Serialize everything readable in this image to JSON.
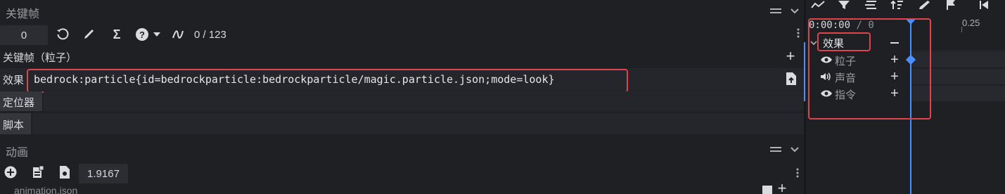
{
  "keyframe_panel": {
    "title": "关键帧",
    "frame_value": "0",
    "frame_count": "0 / 123",
    "section_label": "关键帧（粒子）",
    "effect_label": "效果",
    "effect_value": "bedrock:particle{id=bedrockparticle:bedrockparticle/magic.particle.json;mode=look}",
    "locator_label": "定位器",
    "script_label": "脚本"
  },
  "animation_panel": {
    "title": "动画",
    "time_value": "1.9167",
    "file_label": "animation.json"
  },
  "timeline": {
    "time_display": "0:00:00",
    "time_separator": "/",
    "time_total": "0",
    "ruler_tick": "0.25",
    "tracks": [
      {
        "label": "效果"
      },
      {
        "label": "粒子"
      },
      {
        "label": "声音"
      },
      {
        "label": "指令"
      }
    ]
  },
  "colors": {
    "accent": "#4a8fff",
    "highlight": "#e0434b",
    "background": "#1f2024",
    "panel": "#24262b",
    "input": "#2b2d33"
  }
}
